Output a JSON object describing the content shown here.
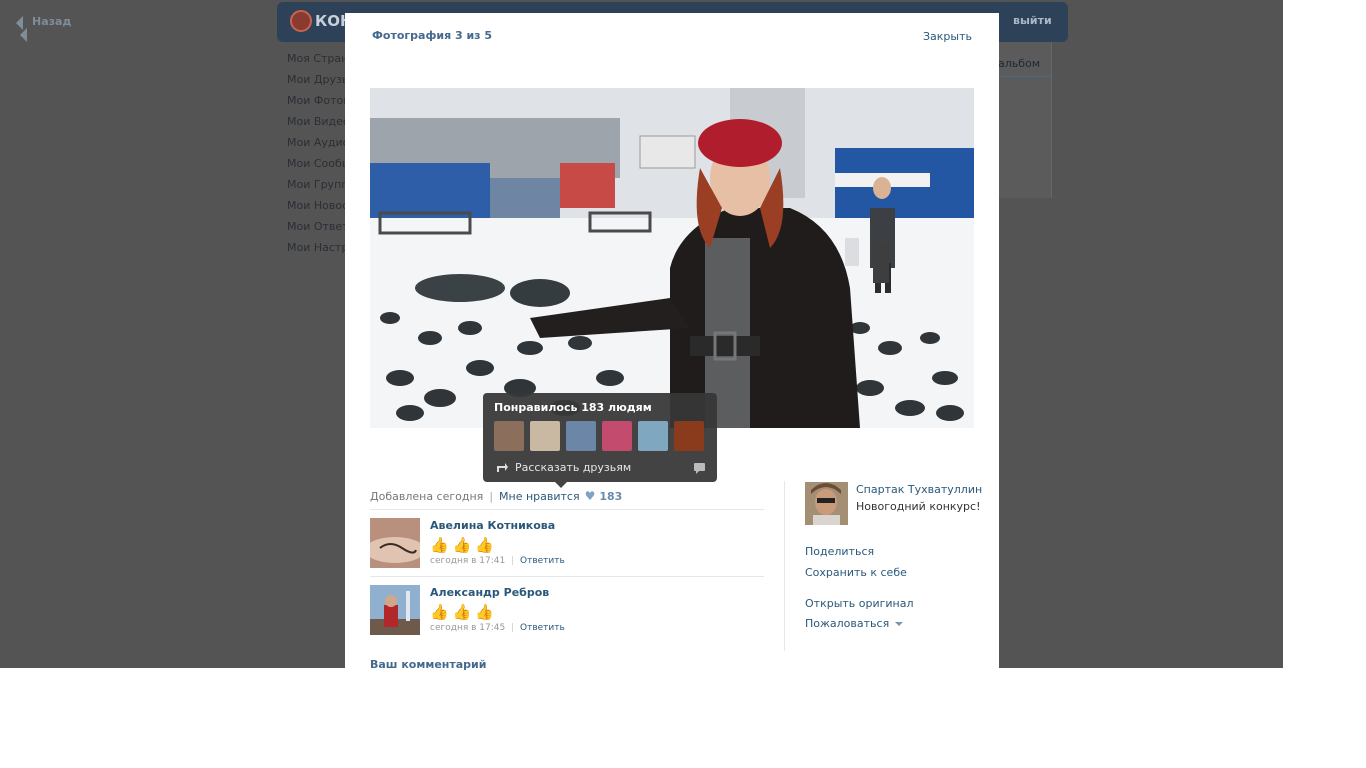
{
  "background": {
    "back_label": "Назад",
    "logo_text": "КОН",
    "exit_label": "выйти",
    "album_tab": "альбом",
    "nav": [
      "Моя Страница",
      "Мои Друзья",
      "Мои Фотографии",
      "Мои Видеозаписи",
      "Мои Аудиозаписи",
      "Мои Сообщения",
      "Мои Группы",
      "Мои Новости",
      "Мои Ответы",
      "Мои Настройки"
    ]
  },
  "viewer": {
    "title": "Фотография 3 из 5",
    "close_label": "Закрыть",
    "added": "Добавлена сегодня",
    "like_label": "Мне нравится",
    "like_count": "183"
  },
  "likes_popup": {
    "title": "Понравилось 183 людям",
    "share_label": "Рассказать друзьям",
    "avatar_colors": [
      "#8c6e5c",
      "#c9b9a3",
      "#6c86a8",
      "#c24b6e",
      "#7fa7bf",
      "#8a3b1c"
    ]
  },
  "comments": [
    {
      "name": "Авелина Котникова",
      "time": "сегодня в 17:41",
      "reply": "Ответить",
      "emojis": [
        "👍",
        "👍",
        "👍"
      ]
    },
    {
      "name": "Александр Ребров",
      "time": "сегодня в 17:45",
      "reply": "Ответить",
      "emojis": [
        "👍",
        "👍",
        "👍"
      ]
    }
  ],
  "your_comment_label": "Ваш комментарий",
  "owner": {
    "name": "Спартак Тухватуллин",
    "album": "Новогодний конкурс!"
  },
  "side_actions": {
    "share": "Поделиться",
    "save": "Сохранить к себе",
    "open_original": "Открыть оригинал",
    "report": "Пожаловаться"
  }
}
